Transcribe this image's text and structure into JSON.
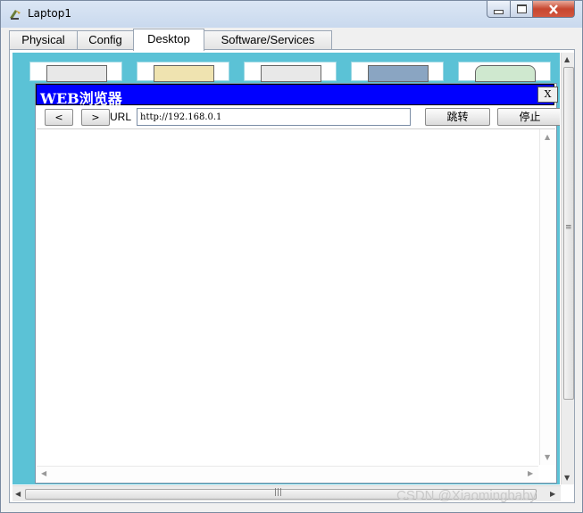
{
  "window": {
    "title": "Laptop1",
    "controls": {
      "minimize": "▁",
      "maximize": "□",
      "close": "✕"
    }
  },
  "tabs": [
    {
      "label": "Physical",
      "active": false
    },
    {
      "label": "Config",
      "active": false
    },
    {
      "label": "Desktop",
      "active": true
    },
    {
      "label": "Software/Services",
      "active": false
    }
  ],
  "browser": {
    "title": "WEB浏览器",
    "close_label": "X",
    "back_label": "<",
    "forward_label": ">",
    "url_label": "URL",
    "url_value": "http://192.168.0.1",
    "go_label": "跳转",
    "stop_label": "停止"
  },
  "scroll_arrows": {
    "up": "▲",
    "down": "▼",
    "left": "◀",
    "right": "▶",
    "grip_v": "≡",
    "grip_h": "|||"
  },
  "watermark": "CSDN @Xiaomingbaby",
  "colors": {
    "browser_title_bg": "#0000ff",
    "desktop_bg": "#5bc2d6"
  }
}
